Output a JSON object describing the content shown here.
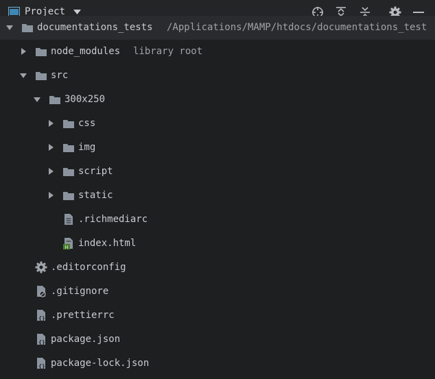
{
  "header": {
    "title": "Project"
  },
  "tree": {
    "root": {
      "label": "documentations_tests",
      "path": "/Applications/MAMP/htdocs/documentations_test"
    },
    "node_modules": {
      "label": "node_modules",
      "hint": "library root"
    },
    "src": {
      "label": "src"
    },
    "folder_300": {
      "label": "300x250"
    },
    "css": {
      "label": "css"
    },
    "img": {
      "label": "img"
    },
    "script": {
      "label": "script"
    },
    "static": {
      "label": "static"
    },
    "richmediarc": {
      "label": ".richmediarc"
    },
    "index": {
      "label": "index.html"
    },
    "editorconfig": {
      "label": ".editorconfig"
    },
    "gitignore": {
      "label": ".gitignore"
    },
    "prettierrc": {
      "label": ".prettierrc"
    },
    "package": {
      "label": "package.json"
    },
    "package_lock": {
      "label": "package-lock.json"
    }
  },
  "colors": {
    "background": "#1e1f21",
    "folder": "#8b949e",
    "html_badge": "#4a7a2e",
    "text": "#c8cbd0"
  }
}
